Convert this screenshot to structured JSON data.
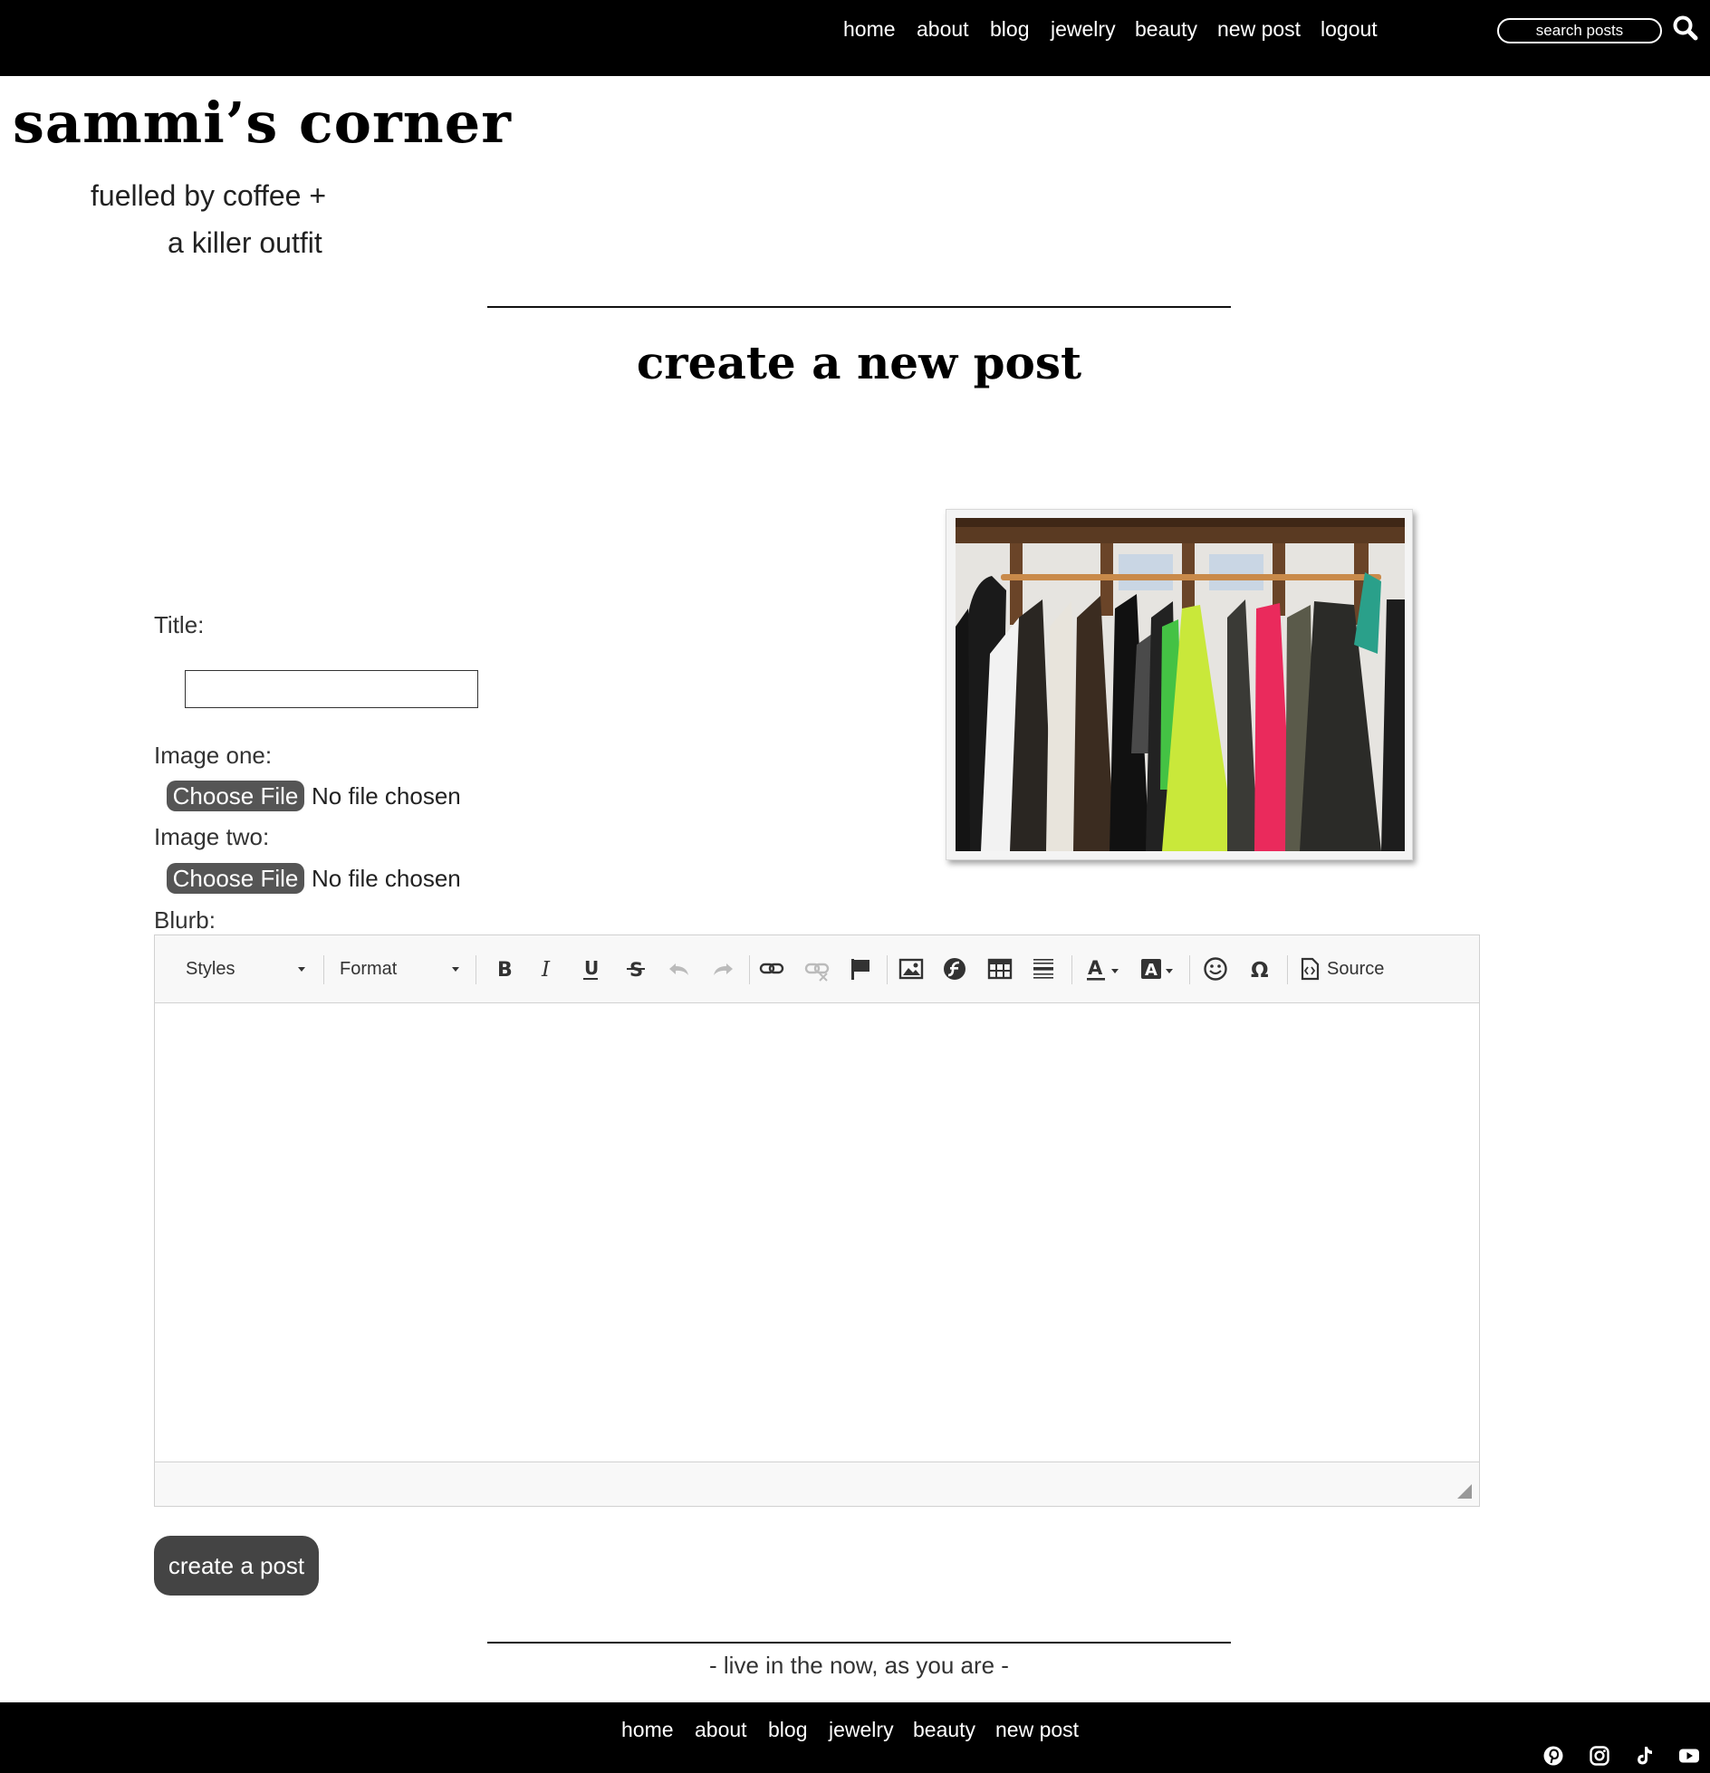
{
  "nav": {
    "items": [
      "home",
      "about",
      "blog",
      "jewelry",
      "beauty",
      "new post",
      "logout"
    ],
    "search_placeholder": "search posts"
  },
  "header": {
    "site_title": "sammi’s corner",
    "tagline_line1": "fuelled by coffee +",
    "tagline_line2": "a killer outfit"
  },
  "page": {
    "heading": "create a new post"
  },
  "form": {
    "title_label": "Title:",
    "title_value": "",
    "image_one_label": "Image one:",
    "image_two_label": "Image two:",
    "choose_file_label": "Choose File",
    "no_file_text": "No file chosen",
    "blurb_label": "Blurb:",
    "submit_label": "create a post"
  },
  "editor": {
    "styles_label": "Styles",
    "format_label": "Format",
    "source_label": "Source",
    "content": ""
  },
  "footer": {
    "motto": "- live in the now, as you are -",
    "items": [
      "home",
      "about",
      "blog",
      "jewelry",
      "beauty",
      "new post"
    ],
    "social_icons": [
      "pinterest-icon",
      "instagram-icon",
      "tiktok-icon",
      "youtube-icon"
    ]
  },
  "colors": {
    "nav_bg": "#000000",
    "button_bg": "#444444",
    "toolbar_bg": "#f8f8f8"
  }
}
